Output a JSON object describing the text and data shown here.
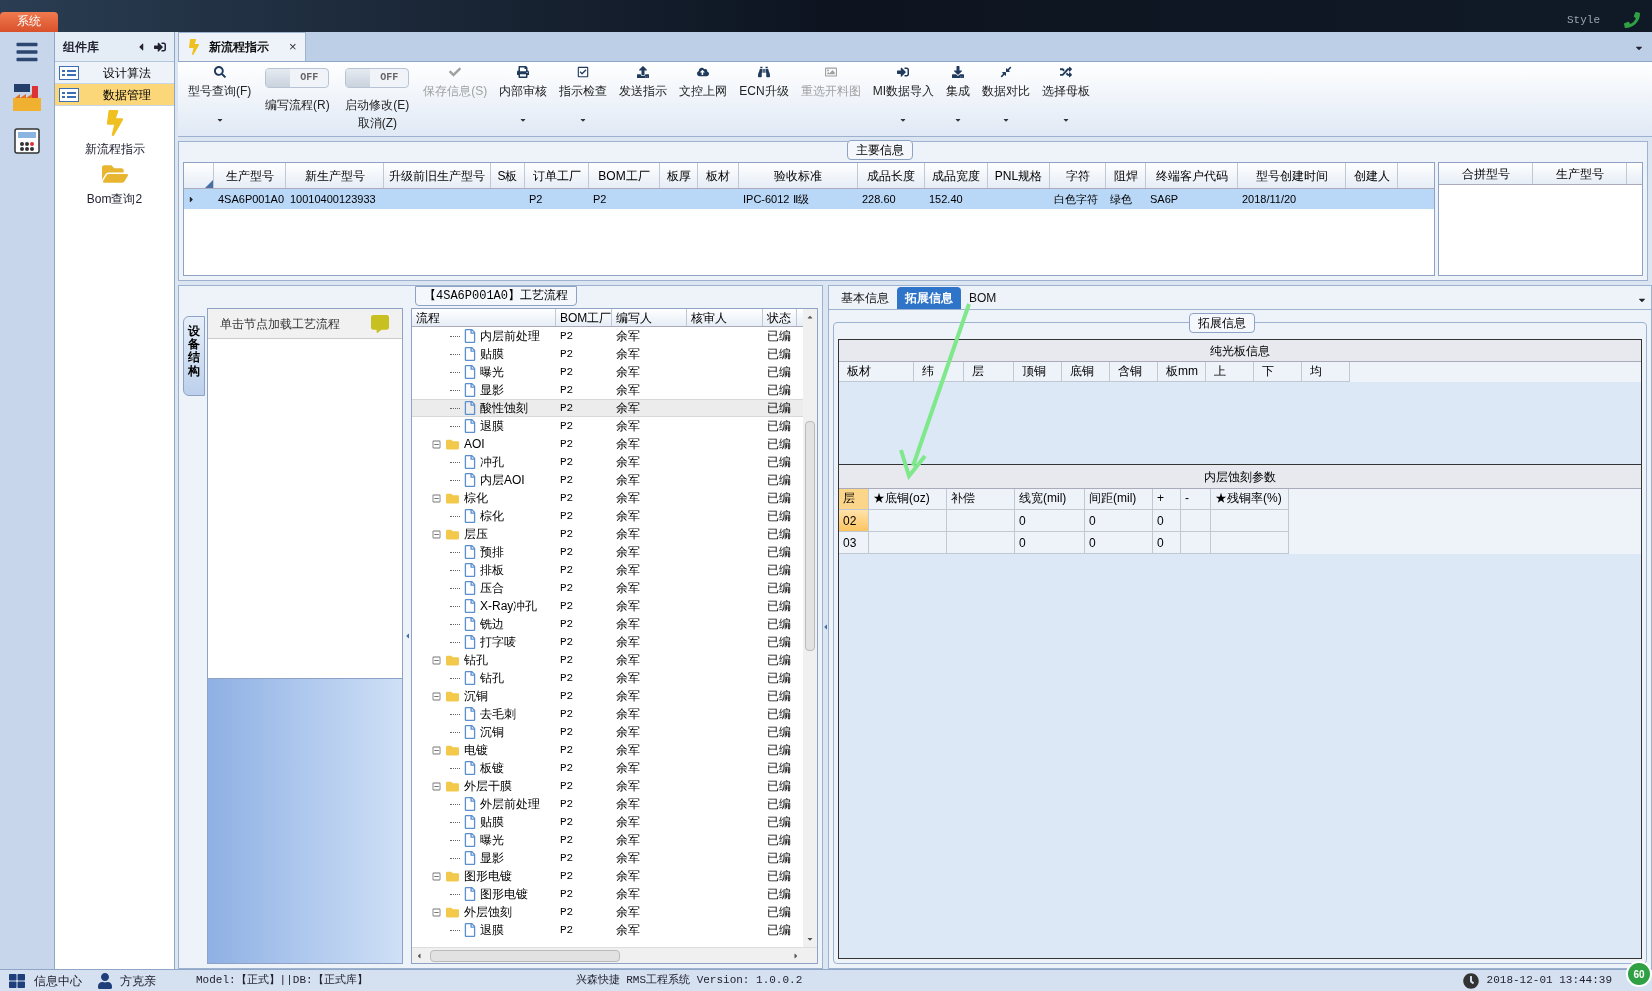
{
  "top_bar": {
    "system_tab": "系统",
    "style_label": "Style"
  },
  "nav_panel": {
    "title": "组件库",
    "categories": [
      {
        "label": "设计算法",
        "selected": false
      },
      {
        "label": "数据管理",
        "selected": true
      }
    ],
    "modules": [
      {
        "label": "新流程指示",
        "kind": "lightning"
      },
      {
        "label": "Bom查询2",
        "kind": "folder"
      }
    ]
  },
  "document_tab": {
    "title": "新流程指示",
    "close": "×"
  },
  "toolbar": [
    {
      "kind": "button",
      "label": "型号查询(F)",
      "disabled": false,
      "dropdown": true
    },
    {
      "kind": "toggle",
      "label": "编写流程(R)",
      "on": false,
      "toggle_text": "OFF"
    },
    {
      "kind": "toggle",
      "label": "启动修改(E)",
      "label2": "取消(Z)",
      "on": false,
      "toggle_text": "OFF"
    },
    {
      "kind": "button",
      "label": "保存信息(S)",
      "disabled": true,
      "dropdown": false
    },
    {
      "kind": "button",
      "label": "内部审核",
      "disabled": false,
      "dropdown": true
    },
    {
      "kind": "button",
      "label": "指示检查",
      "disabled": false,
      "dropdown": true
    },
    {
      "kind": "button",
      "label": "发送指示",
      "disabled": false,
      "dropdown": false
    },
    {
      "kind": "button",
      "label": "文控上网",
      "disabled": false,
      "dropdown": false
    },
    {
      "kind": "button",
      "label": "ECN升级",
      "disabled": false,
      "dropdown": false
    },
    {
      "kind": "button",
      "label": "重选开料图",
      "disabled": true,
      "dropdown": false
    },
    {
      "kind": "button",
      "label": "MI数据导入",
      "disabled": false,
      "dropdown": true
    },
    {
      "kind": "button",
      "label": "集成",
      "disabled": false,
      "dropdown": true
    },
    {
      "kind": "button",
      "label": "数据对比",
      "disabled": false,
      "dropdown": true
    },
    {
      "kind": "button",
      "label": "选择母板",
      "disabled": false,
      "dropdown": true
    }
  ],
  "main_info": {
    "title": "主要信息",
    "columns": [
      "生产型号",
      "新生产型号",
      "升级前旧生产型号",
      "S板",
      "订单工厂",
      "BOM工厂",
      "板厚",
      "板材",
      "验收标准",
      "成品长度",
      "成品宽度",
      "PNL规格",
      "字符",
      "阻焊",
      "终端客户代码",
      "型号创建时间",
      "创建人"
    ],
    "rows": [
      {
        "selected": true,
        "cells": [
          "4SA6P001A0",
          "10010400123933",
          "",
          "",
          "P2",
          "P2",
          "",
          "",
          "IPC-6012 Ⅱ级",
          "228.60",
          "152.40",
          "",
          "白色字符",
          "绿色",
          "SA6P",
          "2018/11/20",
          ""
        ]
      }
    ],
    "merge_columns": [
      "合拼型号",
      "生产型号"
    ]
  },
  "process_panel": {
    "title": "【4SA6P001A0】工艺流程",
    "side_tab": "设备结构",
    "hint": "单击节点加载工艺流程",
    "columns": [
      "流程",
      "BOM工厂",
      "编写人",
      "核审人",
      "状态"
    ],
    "continued": [
      {
        "label": "内层前处理",
        "bom": "P2",
        "writer": "余军",
        "status": "已编",
        "selected": false
      },
      {
        "label": "贴膜",
        "bom": "P2",
        "writer": "余军",
        "status": "已编",
        "selected": false
      },
      {
        "label": "曝光",
        "bom": "P2",
        "writer": "余军",
        "status": "已编",
        "selected": false
      },
      {
        "label": "显影",
        "bom": "P2",
        "writer": "余军",
        "status": "已编",
        "selected": false
      },
      {
        "label": "酸性蚀刻",
        "bom": "P2",
        "writer": "余军",
        "status": "已编",
        "selected": true
      },
      {
        "label": "退膜",
        "bom": "P2",
        "writer": "余军",
        "status": "已编",
        "selected": false
      }
    ],
    "groups": [
      {
        "label": "AOI",
        "bom": "P2",
        "writer": "余军",
        "status": "已编",
        "selected": false,
        "expanded": true,
        "children": [
          {
            "label": "冲孔",
            "bom": "P2",
            "writer": "余军",
            "status": "已编",
            "selected": false
          },
          {
            "label": "内层AOI",
            "bom": "P2",
            "writer": "余军",
            "status": "已编",
            "selected": false
          }
        ]
      },
      {
        "label": "棕化",
        "bom": "P2",
        "writer": "余军",
        "status": "已编",
        "selected": false,
        "expanded": true,
        "children": [
          {
            "label": "棕化",
            "bom": "P2",
            "writer": "余军",
            "status": "已编",
            "selected": false
          }
        ]
      },
      {
        "label": "层压",
        "bom": "P2",
        "writer": "余军",
        "status": "已编",
        "selected": false,
        "expanded": true,
        "children": [
          {
            "label": "预排",
            "bom": "P2",
            "writer": "余军",
            "status": "已编",
            "selected": false
          },
          {
            "label": "排板",
            "bom": "P2",
            "writer": "余军",
            "status": "已编",
            "selected": false
          },
          {
            "label": "压合",
            "bom": "P2",
            "writer": "余军",
            "status": "已编",
            "selected": false
          },
          {
            "label": "X-Ray冲孔",
            "bom": "P2",
            "writer": "余军",
            "status": "已编",
            "selected": false
          },
          {
            "label": "铣边",
            "bom": "P2",
            "writer": "余军",
            "status": "已编",
            "selected": false
          },
          {
            "label": "打字唛",
            "bom": "P2",
            "writer": "余军",
            "status": "已编",
            "selected": false
          }
        ]
      },
      {
        "label": "钻孔",
        "bom": "P2",
        "writer": "余军",
        "status": "已编",
        "selected": false,
        "expanded": true,
        "children": [
          {
            "label": "钻孔",
            "bom": "P2",
            "writer": "余军",
            "status": "已编",
            "selected": false
          }
        ]
      },
      {
        "label": "沉铜",
        "bom": "P2",
        "writer": "余军",
        "status": "已编",
        "selected": false,
        "expanded": true,
        "children": [
          {
            "label": "去毛刺",
            "bom": "P2",
            "writer": "余军",
            "status": "已编",
            "selected": false
          },
          {
            "label": "沉铜",
            "bom": "P2",
            "writer": "余军",
            "status": "已编",
            "selected": false
          }
        ]
      },
      {
        "label": "电镀",
        "bom": "P2",
        "writer": "余军",
        "status": "已编",
        "selected": false,
        "expanded": true,
        "children": [
          {
            "label": "板镀",
            "bom": "P2",
            "writer": "余军",
            "status": "已编",
            "selected": false
          }
        ]
      },
      {
        "label": "外层干膜",
        "bom": "P2",
        "writer": "余军",
        "status": "已编",
        "selected": false,
        "expanded": true,
        "children": [
          {
            "label": "外层前处理",
            "bom": "P2",
            "writer": "余军",
            "status": "已编",
            "selected": false
          },
          {
            "label": "贴膜",
            "bom": "P2",
            "writer": "余军",
            "status": "已编",
            "selected": false
          },
          {
            "label": "曝光",
            "bom": "P2",
            "writer": "余军",
            "status": "已编",
            "selected": false
          },
          {
            "label": "显影",
            "bom": "P2",
            "writer": "余军",
            "status": "已编",
            "selected": false
          }
        ]
      },
      {
        "label": "图形电镀",
        "bom": "P2",
        "writer": "余军",
        "status": "已编",
        "selected": false,
        "expanded": true,
        "children": [
          {
            "label": "图形电镀",
            "bom": "P2",
            "writer": "余军",
            "status": "已编",
            "selected": false
          }
        ]
      },
      {
        "label": "外层蚀刻",
        "bom": "P2",
        "writer": "余军",
        "status": "已编",
        "selected": false,
        "expanded": true,
        "children": [
          {
            "label": "退膜",
            "bom": "P2",
            "writer": "余军",
            "status": "已编",
            "selected": false
          }
        ]
      }
    ]
  },
  "detail_panel": {
    "tabs": [
      {
        "label": "基本信息",
        "selected": false
      },
      {
        "label": "拓展信息",
        "selected": true
      },
      {
        "label": "BOM",
        "selected": false
      }
    ],
    "group_title": "拓展信息",
    "bare_board": {
      "title": "纯光板信息",
      "columns": [
        "板材",
        "纬",
        "层",
        "顶铜",
        "底铜",
        "含铜",
        "板mm",
        "上",
        "下",
        "均"
      ]
    },
    "inner_etch": {
      "title": "内层蚀刻参数",
      "columns": [
        "层",
        "★底铜(oz)",
        "补偿",
        "线宽(mil)",
        "间距(mil)",
        "+",
        "-",
        "★残铜率(%)"
      ],
      "rows": [
        {
          "selected": true,
          "cells": [
            "02",
            "",
            "",
            "0",
            "0",
            "0",
            "",
            ""
          ]
        },
        {
          "selected": false,
          "cells": [
            "03",
            "",
            "",
            "0",
            "0",
            "0",
            "",
            ""
          ]
        }
      ]
    }
  },
  "status_bar": {
    "info_center": "信息中心",
    "user": "方克亲",
    "model": "Model:【正式】||DB:【正式库】",
    "system": "兴森快捷 RMS工程系统 Version: 1.0.0.2",
    "datetime": "2018-12-01 13:44:39",
    "badge": "60"
  }
}
